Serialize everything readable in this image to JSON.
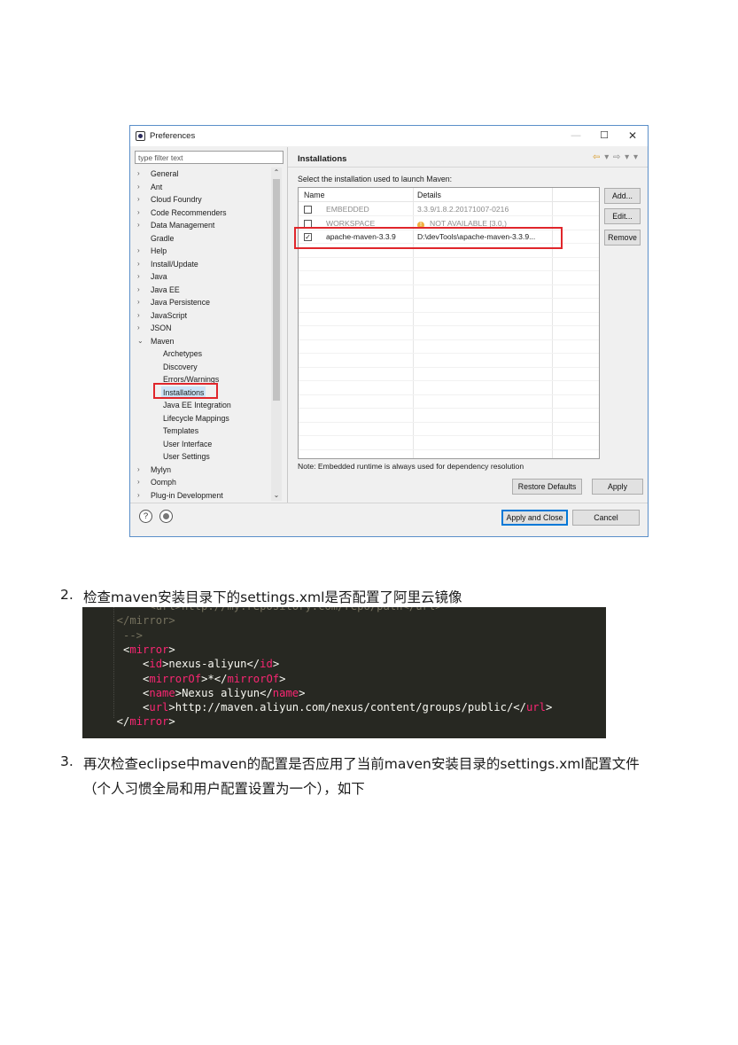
{
  "window": {
    "title": "Preferences",
    "controls": {
      "minimize": "—",
      "maximize": "☐",
      "close": "✕"
    },
    "filter_placeholder": "type filter text",
    "tree": [
      {
        "label": "General",
        "arrow": ">",
        "level": 0
      },
      {
        "label": "Ant",
        "arrow": ">",
        "level": 0
      },
      {
        "label": "Cloud Foundry",
        "arrow": ">",
        "level": 0
      },
      {
        "label": "Code Recommenders",
        "arrow": ">",
        "level": 0
      },
      {
        "label": "Data Management",
        "arrow": ">",
        "level": 0
      },
      {
        "label": "Gradle",
        "arrow": "",
        "level": 0
      },
      {
        "label": "Help",
        "arrow": ">",
        "level": 0
      },
      {
        "label": "Install/Update",
        "arrow": ">",
        "level": 0
      },
      {
        "label": "Java",
        "arrow": ">",
        "level": 0
      },
      {
        "label": "Java EE",
        "arrow": ">",
        "level": 0
      },
      {
        "label": "Java Persistence",
        "arrow": ">",
        "level": 0
      },
      {
        "label": "JavaScript",
        "arrow": ">",
        "level": 0
      },
      {
        "label": "JSON",
        "arrow": ">",
        "level": 0
      },
      {
        "label": "Maven",
        "arrow": "v",
        "level": 0
      },
      {
        "label": "Archetypes",
        "arrow": "",
        "level": 1
      },
      {
        "label": "Discovery",
        "arrow": "",
        "level": 1
      },
      {
        "label": "Errors/Warnings",
        "arrow": "",
        "level": 1
      },
      {
        "label": "Installations",
        "arrow": "",
        "level": 1,
        "selected": true
      },
      {
        "label": "Java EE Integration",
        "arrow": "",
        "level": 1
      },
      {
        "label": "Lifecycle Mappings",
        "arrow": "",
        "level": 1
      },
      {
        "label": "Templates",
        "arrow": "",
        "level": 1
      },
      {
        "label": "User Interface",
        "arrow": "",
        "level": 1
      },
      {
        "label": "User Settings",
        "arrow": "",
        "level": 1
      },
      {
        "label": "Mylyn",
        "arrow": ">",
        "level": 0
      },
      {
        "label": "Oomph",
        "arrow": ">",
        "level": 0
      },
      {
        "label": "Plug-in Development",
        "arrow": ">",
        "level": 0
      }
    ],
    "page_title": "Installations",
    "subtitle": "Select the installation used to launch Maven:",
    "columns": {
      "name": "Name",
      "details": "Details"
    },
    "rows": [
      {
        "checked": false,
        "name": "EMBEDDED",
        "details": "3.3.9/1.8.2.20171007-0216",
        "enabled": false
      },
      {
        "checked": false,
        "name": "WORKSPACE",
        "details": "NOT AVAILABLE [3.0,)",
        "enabled": false,
        "warning": true
      },
      {
        "checked": true,
        "name": "apache-maven-3.3.9",
        "details": "D:\\devTools\\apache-maven-3.3.9...",
        "enabled": true
      }
    ],
    "buttons": {
      "add": "Add...",
      "edit": "Edit...",
      "remove": "Remove",
      "restore_defaults": "Restore Defaults",
      "apply": "Apply",
      "apply_and_close": "Apply and Close",
      "cancel": "Cancel"
    },
    "note": "Note: Embedded runtime is always used for dependency resolution",
    "help_icon": "?"
  },
  "steps": {
    "step2": {
      "number": "2.",
      "text": "检查maven安装目录下的settings.xml是否配置了阿里云镜像"
    },
    "step3": {
      "number": "3.",
      "text_line1": "再次检查eclipse中maven的配置是否应用了当前maven安装目录的settings.xml配置文件",
      "text_line2": "（个人习惯全局和用户配置设置为一个），如下"
    }
  },
  "code": {
    "lines": [
      {
        "parts": [
          {
            "t": "       <url>http://my.repository.com/repo/path</url>",
            "c": "cm"
          }
        ]
      },
      {
        "parts": [
          {
            "t": "  </mirror>",
            "c": "cm"
          }
        ]
      },
      {
        "parts": [
          {
            "t": "   -->",
            "c": "cm"
          }
        ]
      },
      {
        "parts": [
          {
            "t": "   <",
            "c": ""
          },
          {
            "t": "mirror",
            "c": "tag"
          },
          {
            "t": ">",
            "c": ""
          }
        ]
      },
      {
        "parts": [
          {
            "t": "      <",
            "c": ""
          },
          {
            "t": "id",
            "c": "tag"
          },
          {
            "t": ">nexus-aliyun</",
            "c": ""
          },
          {
            "t": "id",
            "c": "tag"
          },
          {
            "t": ">",
            "c": ""
          }
        ]
      },
      {
        "parts": [
          {
            "t": "      <",
            "c": ""
          },
          {
            "t": "mirrorOf",
            "c": "tag"
          },
          {
            "t": ">*</",
            "c": ""
          },
          {
            "t": "mirrorOf",
            "c": "tag"
          },
          {
            "t": ">",
            "c": ""
          }
        ]
      },
      {
        "parts": [
          {
            "t": "      <",
            "c": ""
          },
          {
            "t": "name",
            "c": "tag"
          },
          {
            "t": ">Nexus aliyun</",
            "c": ""
          },
          {
            "t": "name",
            "c": "tag"
          },
          {
            "t": ">",
            "c": ""
          }
        ]
      },
      {
        "parts": [
          {
            "t": "      <",
            "c": ""
          },
          {
            "t": "url",
            "c": "tag"
          },
          {
            "t": ">http://maven.aliyun.com/nexus/content/groups/public/</",
            "c": ""
          },
          {
            "t": "url",
            "c": "tag"
          },
          {
            "t": ">",
            "c": ""
          }
        ]
      },
      {
        "parts": [
          {
            "t": "  </",
            "c": ""
          },
          {
            "t": "mirror",
            "c": "tag"
          },
          {
            "t": ">",
            "c": ""
          }
        ]
      }
    ]
  },
  "colors": {
    "highlight_box": "#e0262b",
    "code_bg": "#272822",
    "code_tag": "#f92672",
    "selection": "#cce4f7"
  }
}
